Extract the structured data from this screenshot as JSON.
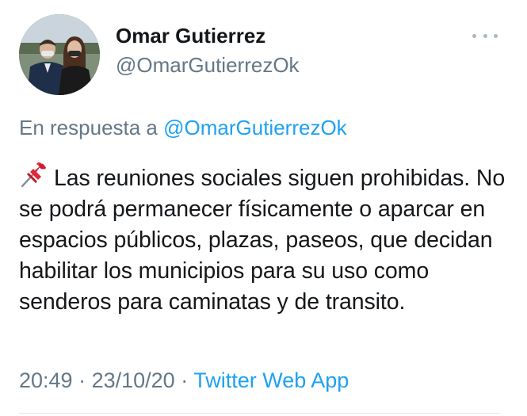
{
  "tweet": {
    "author": {
      "name": "Omar Gutierrez",
      "handle": "@OmarGutierrezOk"
    },
    "reply": {
      "prefix": "En respuesta a ",
      "handle": "@OmarGutierrezOk"
    },
    "text": "Las reuniones sociales siguen prohibidas. No se podrá permanecer físicamente o aparcar en espacios públicos, plazas, paseos, que decidan habilitar los municipios para su uso como senderos para caminatas y de transito.",
    "pin_icon": "pushpin-icon",
    "time": "20:49",
    "separator": " · ",
    "date": "23/10/20",
    "source": "Twitter Web App",
    "more_icon": "more-horizontal-icon"
  },
  "colors": {
    "text": "#14171a",
    "muted": "#657786",
    "link": "#1da1f2",
    "divider": "#e1e8ed"
  }
}
